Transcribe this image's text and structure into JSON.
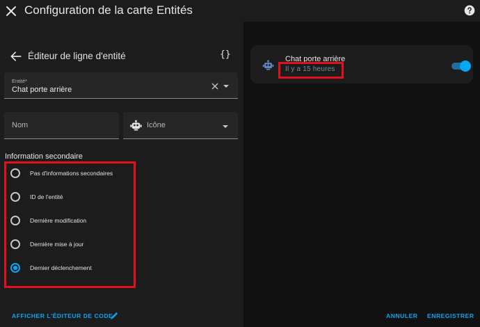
{
  "dialog": {
    "title": "Configuration de la carte Entités",
    "close_icon": "close-icon",
    "help_icon": "help-circle-icon"
  },
  "editor": {
    "title": "Éditeur de ligne d'entité",
    "back_icon": "arrow-left-icon",
    "code_toggle": "{}",
    "entity_field": {
      "label": "Entité*",
      "value": "Chat porte arrière"
    },
    "name_field": {
      "placeholder": "Nom"
    },
    "icon_field": {
      "placeholder": "Icône",
      "icon": "robot-icon"
    },
    "secondary_info": {
      "title": "Information secondaire",
      "options": [
        {
          "label": "Pas d'informations secondaires",
          "checked": false
        },
        {
          "label": "ID de l'entité",
          "checked": false
        },
        {
          "label": "Dernière modification",
          "checked": false
        },
        {
          "label": "Dernière mise à jour",
          "checked": false
        },
        {
          "label": "Dernier déclenchement",
          "checked": true
        }
      ]
    }
  },
  "preview": {
    "entity_name": "Chat porte arrière",
    "status": "Il y a 15 heures",
    "toggle_on": true,
    "icon": "robot-icon"
  },
  "footer": {
    "show_code_editor": "AFFICHER L'ÉDITEUR DE CODE",
    "pencil_icon": "pencil-icon",
    "cancel": "ANNULER",
    "save": "ENREGISTRER"
  },
  "colors": {
    "accent": "#03a9f4",
    "highlight": "#e0101f",
    "background": "#1c1c1c",
    "preview_background": "#111111",
    "robot_icon": "#5f86b8"
  }
}
